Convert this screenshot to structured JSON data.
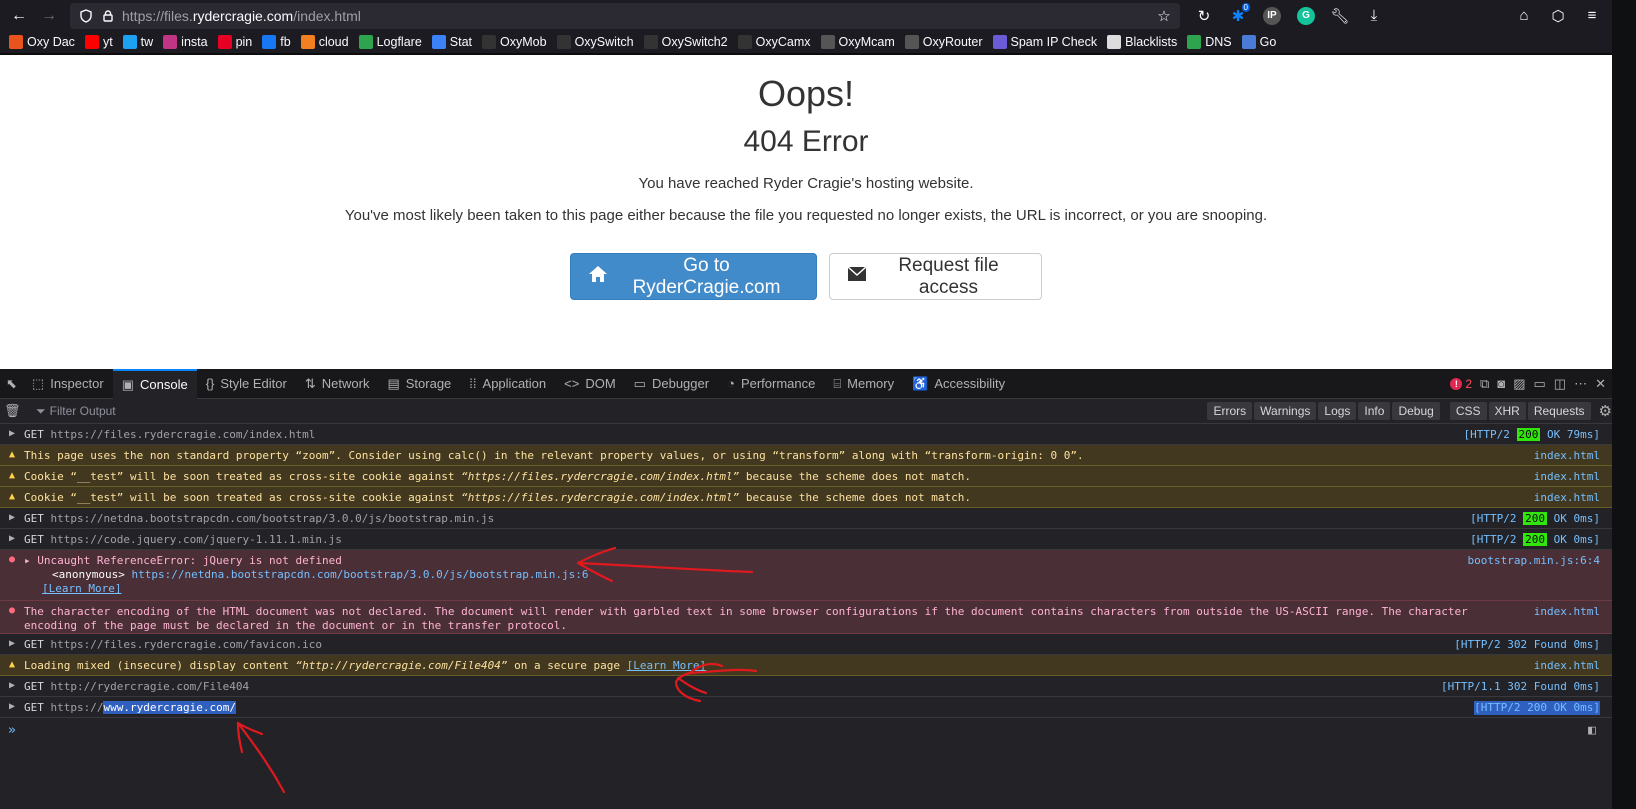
{
  "browser": {
    "url_prefix": "https://files.",
    "url_domain": "rydercragie.com",
    "url_suffix": "/index.html",
    "addon_badge": "0"
  },
  "bookmarks": [
    {
      "label": "Oxy Dac",
      "icon": "oxy-dac-icon",
      "color": "#e8531e"
    },
    {
      "label": "yt",
      "icon": "youtube-icon",
      "color": "#ff0000"
    },
    {
      "label": "tw",
      "icon": "twitter-icon",
      "color": "#1da1f2"
    },
    {
      "label": "insta",
      "icon": "instagram-icon",
      "color": "#c13584"
    },
    {
      "label": "pin",
      "icon": "pinterest-icon",
      "color": "#e60023"
    },
    {
      "label": "fb",
      "icon": "facebook-icon",
      "color": "#1877f2"
    },
    {
      "label": "cloud",
      "icon": "cloudflare-icon",
      "color": "#f38020"
    },
    {
      "label": "Logflare",
      "icon": "logflare-icon",
      "color": "#2ea44f"
    },
    {
      "label": "Stat",
      "icon": "stat-icon",
      "color": "#3b82f6"
    },
    {
      "label": "OxyMob",
      "icon": "oxymob-icon",
      "color": "#333333"
    },
    {
      "label": "OxySwitch",
      "icon": "oxyswitch-icon",
      "color": "#333333"
    },
    {
      "label": "OxySwitch2",
      "icon": "oxyswitch2-icon",
      "color": "#333333"
    },
    {
      "label": "OxyCamx",
      "icon": "oxycamx-icon",
      "color": "#333333"
    },
    {
      "label": "OxyMcam",
      "icon": "globe-icon",
      "color": "#555555"
    },
    {
      "label": "OxyRouter",
      "icon": "globe-icon",
      "color": "#555555"
    },
    {
      "label": "Spam IP Check",
      "icon": "spam-ip-icon",
      "color": "#6b5bd6"
    },
    {
      "label": "Blacklists",
      "icon": "blacklists-icon",
      "color": "#dddddd"
    },
    {
      "label": "DNS",
      "icon": "dns-check-icon",
      "color": "#2ea44f"
    },
    {
      "label": "Go",
      "icon": "go-icon",
      "color": "#4a7bd6"
    }
  ],
  "page": {
    "title": "Oops!",
    "subtitle": "404 Error",
    "line1": "You have reached Ryder Cragie's hosting website.",
    "line2": "You've most likely been taken to this page either because the file you requested no longer exists, the URL is incorrect, or you are snooping.",
    "primary_button": "Go to RyderCragie.com",
    "secondary_button": "Request file access"
  },
  "devtools": {
    "tabs": [
      {
        "label": "Inspector",
        "icon": "inspector-icon",
        "glyph": "⬚"
      },
      {
        "label": "Console",
        "icon": "console-icon",
        "glyph": "▣",
        "active": true
      },
      {
        "label": "Style Editor",
        "icon": "style-editor-icon",
        "glyph": "{}"
      },
      {
        "label": "Network",
        "icon": "network-icon",
        "glyph": "⇅"
      },
      {
        "label": "Storage",
        "icon": "storage-icon",
        "glyph": "▤"
      },
      {
        "label": "Application",
        "icon": "application-icon",
        "glyph": "⁞⁞"
      },
      {
        "label": "DOM",
        "icon": "dom-icon",
        "glyph": "<>"
      },
      {
        "label": "Debugger",
        "icon": "debugger-icon",
        "glyph": "▭"
      },
      {
        "label": "Performance",
        "icon": "performance-icon",
        "glyph": "◔"
      },
      {
        "label": "Memory",
        "icon": "memory-icon",
        "glyph": "⌸"
      },
      {
        "label": "Accessibility",
        "icon": "accessibility-icon",
        "glyph": "♿"
      }
    ],
    "error_count": "2",
    "filter_placeholder": "Filter Output",
    "filters": [
      "Errors",
      "Warnings",
      "Logs",
      "Info",
      "Debug"
    ],
    "filters2": [
      "CSS",
      "XHR",
      "Requests"
    ],
    "rows": {
      "r1": {
        "method": "GET",
        "url": "https://files.rydercragie.com/index.html",
        "status_pre": "[HTTP/2 ",
        "status": "200",
        "status_post": " OK 79ms]"
      },
      "r2": {
        "msg": "This page uses the non standard property “zoom”. Consider using calc() in the relevant property values, or using “transform” along with “transform-origin: 0 0”.",
        "src": "index.html"
      },
      "r3": {
        "msg_pre": "Cookie “__test” will be soon treated as cross-site cookie against ",
        "msg_em": "“https://files.rydercragie.com/index.html”",
        "msg_post": " because the scheme does not match.",
        "src": "index.html"
      },
      "r4": {
        "msg_pre": "Cookie “__test” will be soon treated as cross-site cookie against ",
        "msg_em": "“https://files.rydercragie.com/index.html”",
        "msg_post": " because the scheme does not match.",
        "src": "index.html"
      },
      "r5": {
        "method": "GET",
        "url": "https://netdna.bootstrapcdn.com/bootstrap/3.0.0/js/bootstrap.min.js",
        "status_pre": "[HTTP/2 ",
        "status": "200",
        "status_post": " OK 0ms]"
      },
      "r6": {
        "method": "GET",
        "url": "https://code.jquery.com/jquery-1.11.1.min.js",
        "status_pre": "[HTTP/2 ",
        "status": "200",
        "status_post": " OK 0ms]"
      },
      "r7": {
        "msg": "Uncaught ReferenceError: jQuery is not defined",
        "anon": "<anonymous>",
        "anon_link": "https://netdna.bootstrapcdn.com/bootstrap/3.0.0/js/bootstrap.min.js:6",
        "learn": "[Learn More]",
        "src": "bootstrap.min.js:6:4"
      },
      "r8": {
        "msg": "The character encoding of the HTML document was not declared. The document will render with garbled text in some browser configurations if the document contains characters from outside the US-ASCII range. The character encoding of the page must be declared in the document or in the transfer protocol.",
        "src": "index.html"
      },
      "r9": {
        "method": "GET",
        "url": "https://files.rydercragie.com/favicon.ico",
        "status": "[HTTP/2 302 Found 0ms]"
      },
      "r10": {
        "msg_pre": "Loading mixed (insecure) display content ",
        "msg_em": "“http://rydercragie.com/File404”",
        "msg_post": " on a secure page ",
        "learn": "[Learn More]",
        "src": "index.html"
      },
      "r11": {
        "method": "GET",
        "url": "http://rydercragie.com/File404",
        "status": "[HTTP/1.1 302 Found 0ms]"
      },
      "r12": {
        "method": "GET",
        "url_pre": "https://",
        "url_sel": "www.rydercragie.com/",
        "status_pre": "[HTTP/2 ",
        "status": "200",
        "status_post": " OK 0ms]"
      }
    },
    "prompt": "»"
  }
}
